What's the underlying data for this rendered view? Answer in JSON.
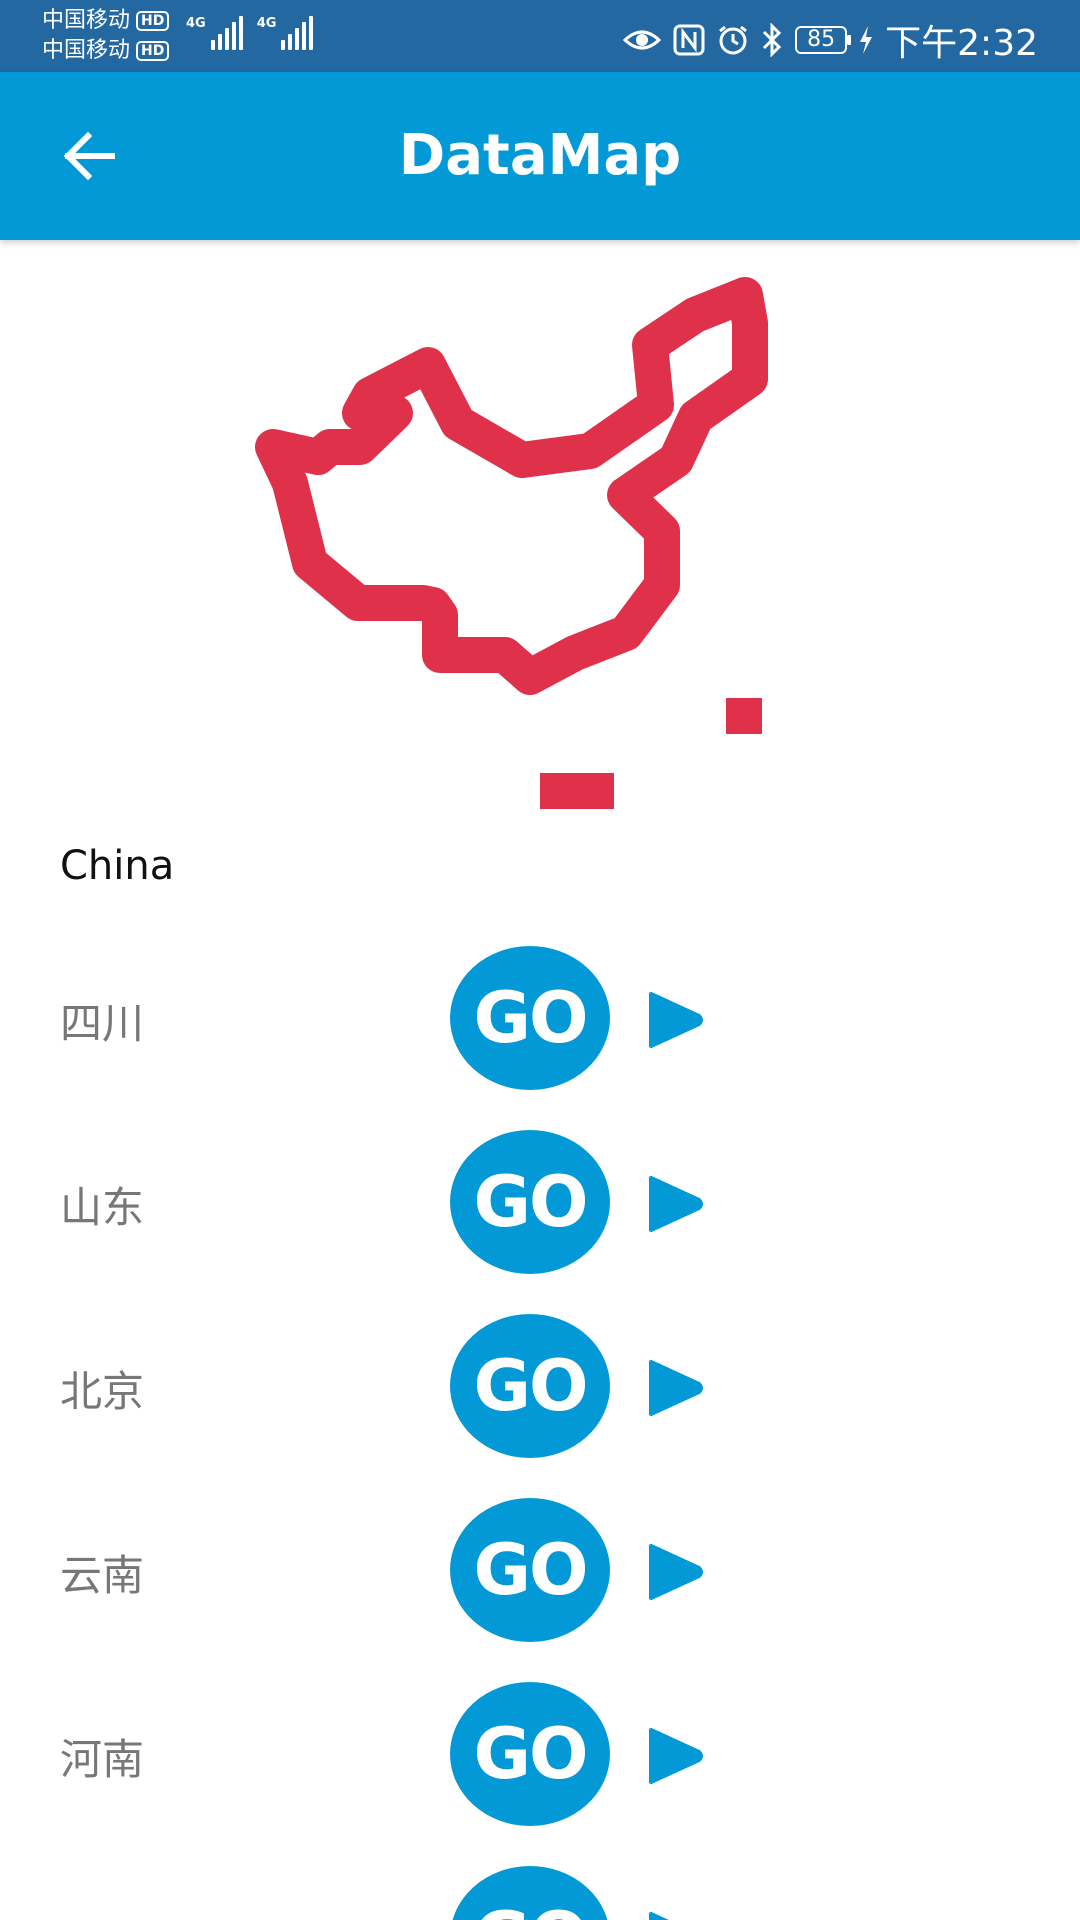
{
  "status_bar": {
    "carrier_1": "中国移动",
    "carrier_2": "中国移动",
    "hd_badge": "HD",
    "network_1": "4G",
    "network_2": "4G",
    "battery_level": "85",
    "time": "下午2:32",
    "icons": [
      "eye-icon",
      "nfc-icon",
      "alarm-icon",
      "bluetooth-icon",
      "battery-icon",
      "charging-icon"
    ]
  },
  "app_bar": {
    "title": "DataMap",
    "back_icon": "arrow-left-icon"
  },
  "map": {
    "region": "China",
    "stroke_color": "#e0314b"
  },
  "country_label": "China",
  "regions": [
    {
      "name": "四川",
      "go_label": "GO"
    },
    {
      "name": "山东",
      "go_label": "GO"
    },
    {
      "name": "北京",
      "go_label": "GO"
    },
    {
      "name": "云南",
      "go_label": "GO"
    },
    {
      "name": "河南",
      "go_label": "GO"
    },
    {
      "name": "",
      "go_label": "GO"
    }
  ],
  "colors": {
    "status_bar": "#2468a2",
    "app_bar": "#0399d6",
    "accent": "#0399d6",
    "map_red": "#e0314b",
    "region_text": "#777777"
  }
}
